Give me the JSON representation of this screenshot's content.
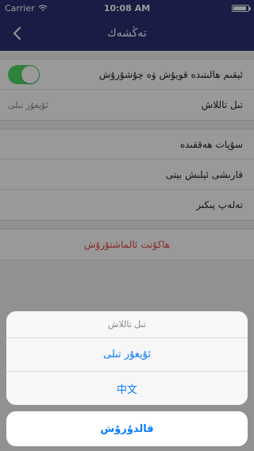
{
  "status_bar": {
    "carrier": "Carrier",
    "time": "10:08 AM",
    "battery_level": 0.9
  },
  "navbar": {
    "title": "تەڭشەك",
    "back_icon": "chevron-left-icon"
  },
  "settings": {
    "rows": [
      {
        "label": "ئېقىم ھالىتىدە قويۇش ۋە چۇشۇرۇش",
        "toggle_on": true
      },
      {
        "label": "تىل تاللاش",
        "value": "ئۇيغۇر تىلى"
      }
    ],
    "rows2": [
      {
        "label": "سۇپات ھەققىدە"
      },
      {
        "label": "قارىشى ئېلىش بېتى"
      },
      {
        "label": "تەلەپ پىكىر"
      }
    ],
    "logout_label": "ھاكۇنت ئالماشتۇرۇش"
  },
  "action_sheet": {
    "title": "تىل تاللاش",
    "options": [
      "ئۇيغۇر تىلى",
      "中文"
    ],
    "cancel_label": "قالدۇرۇش"
  },
  "colors": {
    "nav_bg": "#2b2f72",
    "toggle_on": "#4cd964",
    "action_blue": "#0a7cff",
    "destructive_red": "#e34949"
  }
}
